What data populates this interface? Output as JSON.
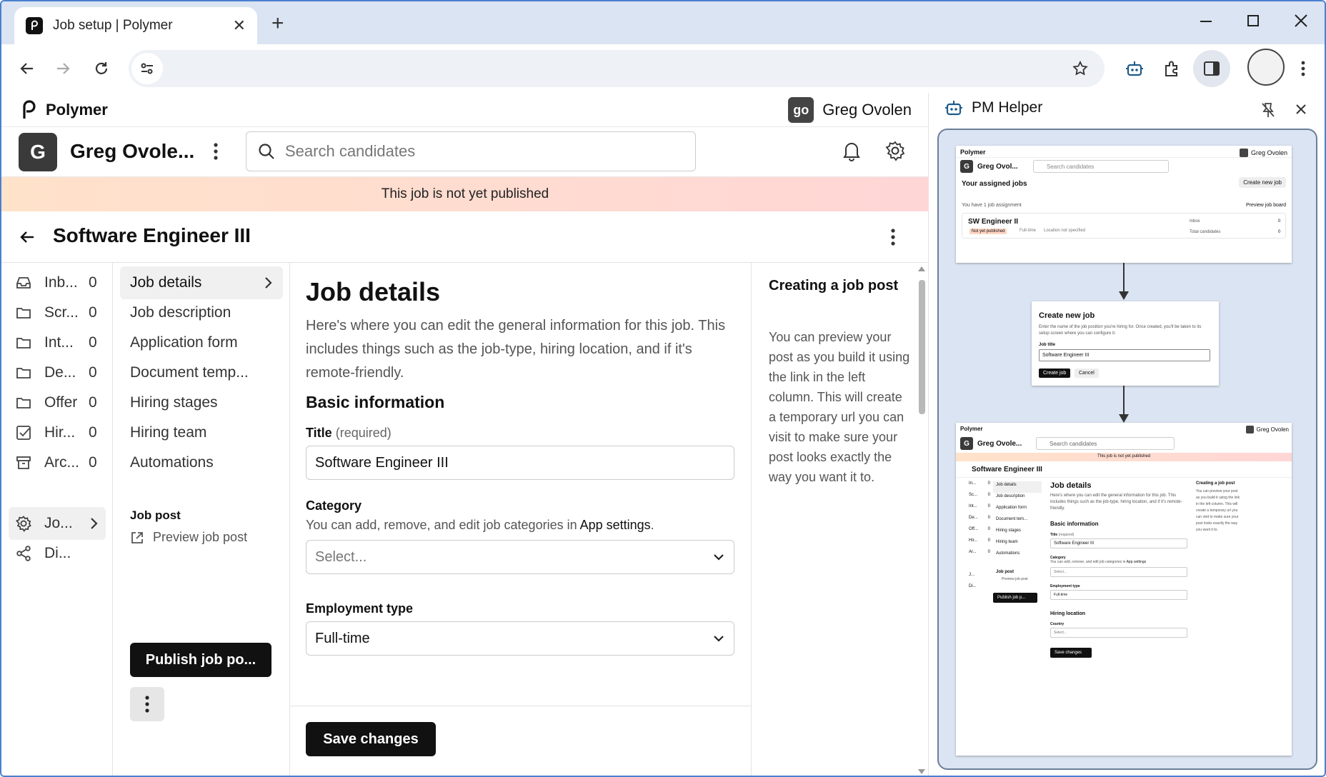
{
  "browser": {
    "tab_title": "Job setup | Polymer",
    "new_tab": "+",
    "close_tab": "✕"
  },
  "app": {
    "brand": "Polymer",
    "user_initials": "go",
    "user_name": "Greg Ovolen",
    "org_initial": "G",
    "org_name": "Greg Ovole...",
    "search_placeholder": "Search candidates",
    "banner": "This job is not yet published",
    "job_title": "Software Engineer III"
  },
  "left_nav": [
    {
      "icon": "inbox-icon",
      "label": "Inb...",
      "count": "0"
    },
    {
      "icon": "folder-icon",
      "label": "Scr...",
      "count": "0"
    },
    {
      "icon": "folder-icon",
      "label": "Int...",
      "count": "0"
    },
    {
      "icon": "folder-icon",
      "label": "De...",
      "count": "0"
    },
    {
      "icon": "folder-icon",
      "label": "Offer",
      "count": "0"
    },
    {
      "icon": "checkbox-icon",
      "label": "Hir...",
      "count": "0"
    },
    {
      "icon": "archive-icon",
      "label": "Arc...",
      "count": "0"
    }
  ],
  "left_nav_bottom": {
    "job_setup": "Jo...",
    "share": "Di..."
  },
  "mid_nav": {
    "items": [
      "Job details",
      "Job description",
      "Application form",
      "Document temp...",
      "Hiring stages",
      "Hiring team",
      "Automations"
    ],
    "job_post_heading": "Job post",
    "preview": "Preview job post",
    "publish": "Publish job po..."
  },
  "content": {
    "heading": "Job details",
    "intro": "Here's where you can edit the general information for this job. This includes things such as the job-type, hiring location, and if it's remote-friendly.",
    "basic_info": "Basic information",
    "title_label": "Title",
    "title_req": "(required)",
    "title_value": "Software Engineer III",
    "category_label": "Category",
    "category_help": "You can add, remove, and edit job categories in",
    "category_link": "App settings",
    "category_help_end": ".",
    "category_value": "Select...",
    "employment_label": "Employment type",
    "employment_value": "Full-time",
    "save": "Save changes"
  },
  "tip": {
    "title": "Creating a job post",
    "body": "You can preview your post as you build it using the link in the left column. This will create a temporary url you can visit to make sure your post looks exactly the way you want it to."
  },
  "helper": {
    "title": "PM Helper",
    "mini1": {
      "brand": "Polymer",
      "user": "Greg Ovolen",
      "org": "Greg Ovol...",
      "search": "Search candidates",
      "assigned": "Your assigned jobs",
      "create": "Create new job",
      "count_text": "You have 1 job assignment",
      "preview_board": "Preview job board",
      "job": "SW Engineer II",
      "badge": "Not yet published",
      "type": "Full-time",
      "location": "Location not specified",
      "inbox": "Inbox",
      "inbox_n": "0",
      "total": "Total candidates",
      "total_n": "0"
    },
    "modal": {
      "title": "Create new job",
      "desc": "Enter the name of the job position you're hiring for. Once created, you'll be taken to its setup screen where you can configure it.",
      "label": "Job title",
      "value": "Software Engineer III",
      "create": "Create job",
      "cancel": "Cancel"
    },
    "mini2": {
      "brand": "Polymer",
      "user": "Greg Ovolen",
      "org": "Greg Ovole...",
      "search": "Search candidates",
      "banner": "This job is not yet published",
      "job": "Software Engineer III",
      "nav": [
        "In...",
        "Sc...",
        "Int...",
        "De...",
        "Off...",
        "Hir...",
        "Ar..."
      ],
      "nav_counts": [
        "0",
        "0",
        "0",
        "0",
        "0",
        "0",
        "0"
      ],
      "nav_bottom": [
        "J...",
        "Di..."
      ],
      "mid": [
        "Job details",
        "Job description",
        "Application form",
        "Document tem...",
        "Hiring stages",
        "Hiring team",
        "Automations"
      ],
      "job_post": "Job post",
      "preview": "Preview job post",
      "publish": "Publish job p...",
      "heading": "Job details",
      "intro": "Here's where you can edit the general information for this job. This includes things such as the job-type, hiring location, and if it's remote-friendly.",
      "basic": "Basic information",
      "title_label": "Title",
      "title_req": "(required)",
      "title_value": "Software Engineer III",
      "category": "Category",
      "category_help": "You can add, remove, and edit job categories in",
      "category_link": "App settings",
      "select": "Select...",
      "employment": "Employment type",
      "fulltime": "Full-time",
      "hiring_location": "Hiring location",
      "country": "Country",
      "country_value": "Select...",
      "save": "Save changes",
      "tip_title": "Creating a job post",
      "tip_body": "You can preview your post as you build it using the link in the left column. This will create a temporary url you can visit to make sure your post looks exactly the way you want it to."
    }
  }
}
